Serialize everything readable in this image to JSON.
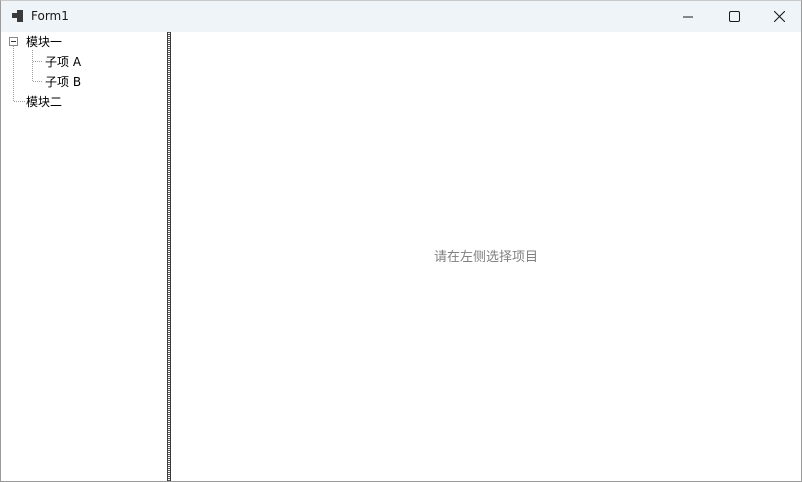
{
  "window": {
    "title": "Form1",
    "controls": {
      "minimize_icon": "minimize-icon",
      "maximize_icon": "maximize-icon",
      "close_icon": "close-icon"
    }
  },
  "tree": {
    "nodes": [
      {
        "label": "模块一",
        "expanded": true,
        "children": [
          {
            "label": "子项 A"
          },
          {
            "label": "子项 B"
          }
        ]
      },
      {
        "label": "模块二",
        "expanded": false,
        "children": []
      }
    ]
  },
  "content": {
    "placeholder": "请在左侧选择项目"
  },
  "colors": {
    "titlebar_bg": "#eff4f9",
    "placeholder_text": "#808080",
    "tree_line": "#a0a0a0"
  }
}
